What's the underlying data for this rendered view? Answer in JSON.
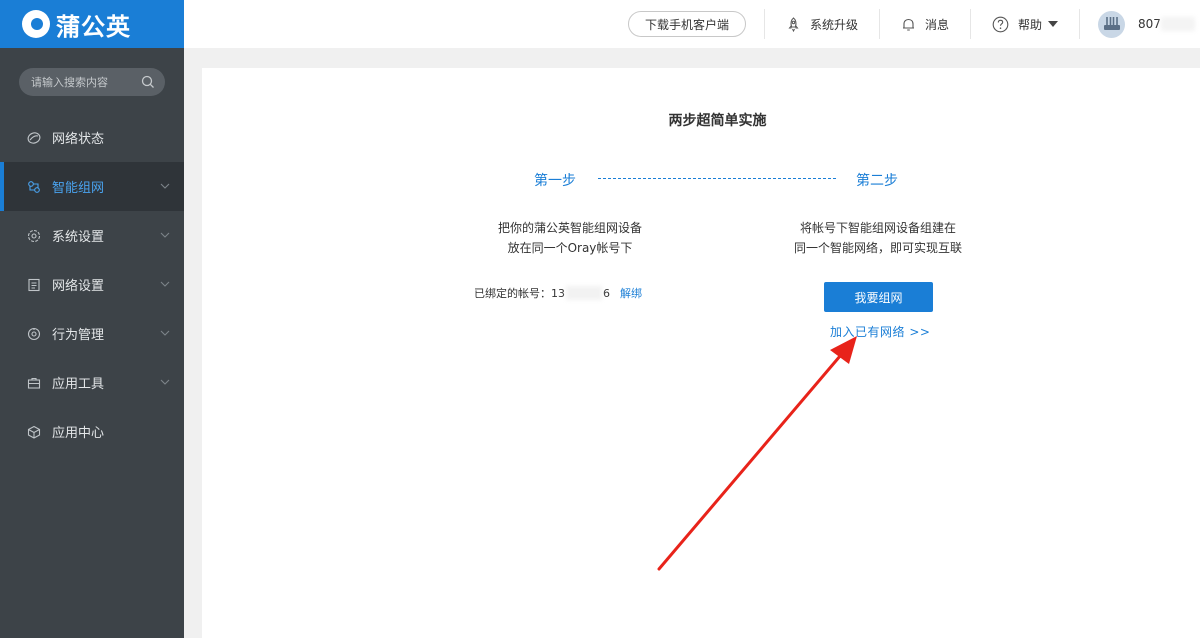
{
  "app": {
    "brand": "蒲公英"
  },
  "sidebar": {
    "search_placeholder": "请输入搜索内容",
    "items": [
      {
        "label": "网络状态",
        "icon": "network-status-icon",
        "active": false,
        "has_submenu": false
      },
      {
        "label": "智能组网",
        "icon": "smart-network-icon",
        "active": true,
        "has_submenu": true
      },
      {
        "label": "系统设置",
        "icon": "gear-icon",
        "active": false,
        "has_submenu": true
      },
      {
        "label": "网络设置",
        "icon": "document-icon",
        "active": false,
        "has_submenu": true
      },
      {
        "label": "行为管理",
        "icon": "behavior-icon",
        "active": false,
        "has_submenu": true
      },
      {
        "label": "应用工具",
        "icon": "toolbox-icon",
        "active": false,
        "has_submenu": true
      },
      {
        "label": "应用中心",
        "icon": "cube-icon",
        "active": false,
        "has_submenu": false
      }
    ]
  },
  "topbar": {
    "download_label": "下载手机客户端",
    "upgrade_label": "系统升级",
    "messages_label": "消息",
    "help_label": "帮助",
    "user_id_prefix": "807"
  },
  "main": {
    "title": "两步超简单实施",
    "step1": {
      "label": "第一步",
      "line1": "把你的蒲公英智能组网设备",
      "line2": "放在同一个Oray帐号下"
    },
    "step2": {
      "label": "第二步",
      "line1": "将帐号下智能组网设备组建在",
      "line2": "同一个智能网络，即可实现互联"
    },
    "bound_label": "已绑定的帐号：",
    "account_prefix": "13",
    "account_suffix": "6",
    "unbind_label": "解绑",
    "create_button": "我要组网",
    "join_link": "加入已有网络 >>"
  },
  "colors": {
    "brand": "#1a7ed6",
    "sidebar_bg": "#3d4348",
    "arrow": "#e8231a"
  }
}
